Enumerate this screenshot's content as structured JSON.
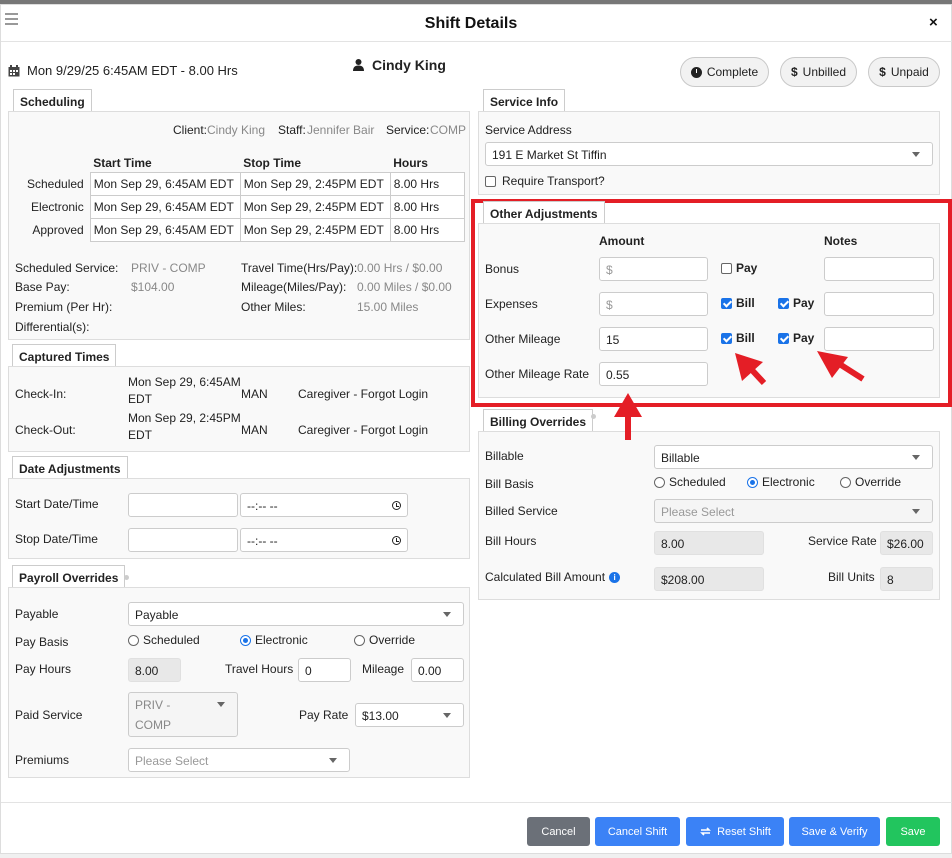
{
  "window": {
    "title": "Shift Details",
    "close": "×"
  },
  "header": {
    "date_line": "Mon 9/29/25 6:45AM EDT - 8.00 Hrs",
    "person": "Cindy King",
    "buttons": {
      "complete": "Complete",
      "unbilled": "Unbilled",
      "unpaid": "Unpaid",
      "dollar": "$"
    }
  },
  "scheduling": {
    "tab": "Scheduling",
    "client_label": "Client:",
    "client": "Cindy King",
    "staff_label": "Staff:",
    "staff": "Jennifer Bair",
    "service_label": "Service:",
    "service": "COMP",
    "columns": [
      "Start Time",
      "Stop Time",
      "Hours"
    ],
    "rows": [
      {
        "label": "Scheduled",
        "start": "Mon Sep 29, 6:45AM EDT",
        "stop": "Mon Sep 29, 2:45PM EDT",
        "hours": "8.00 Hrs"
      },
      {
        "label": "Electronic",
        "start": "Mon Sep 29, 6:45AM EDT",
        "stop": "Mon Sep 29, 2:45PM EDT",
        "hours": "8.00 Hrs"
      },
      {
        "label": "Approved",
        "start": "Mon Sep 29, 6:45AM EDT",
        "stop": "Mon Sep 29, 2:45PM EDT",
        "hours": "8.00 Hrs"
      }
    ],
    "scheduled_service_label": "Scheduled Service:",
    "scheduled_service": "PRIV - COMP",
    "base_pay_label": "Base Pay:",
    "base_pay": "$104.00",
    "premium_label": "Premium (Per Hr):",
    "differential_label": "Differential(s):",
    "travel_label": "Travel Time(Hrs/Pay):",
    "travel": "0.00 Hrs / $0.00",
    "mileage_label": "Mileage(Miles/Pay):",
    "mileage": "0.00 Miles / $0.00",
    "other_miles_label": "Other Miles:",
    "other_miles": "15.00 Miles"
  },
  "captured": {
    "tab": "Captured Times",
    "checkin_label": "Check-In:",
    "checkin_l1": "Mon Sep 29, 6:45AM",
    "checkin_l2": "EDT",
    "checkin_method": "MAN",
    "checkin_reason": "Caregiver - Forgot Login",
    "checkout_label": "Check-Out:",
    "checkout_l1": "Mon Sep 29, 2:45PM",
    "checkout_l2": "EDT",
    "checkout_method": "MAN",
    "checkout_reason": "Caregiver - Forgot Login"
  },
  "date_adj": {
    "tab": "Date Adjustments",
    "start_label": "Start Date/Time",
    "stop_label": "Stop Date/Time",
    "time_placeholder": "--:-- --"
  },
  "payroll": {
    "tab": "Payroll Overrides",
    "payable_label": "Payable",
    "payable": "Payable",
    "pay_basis_label": "Pay Basis",
    "basis": [
      "Scheduled",
      "Electronic",
      "Override"
    ],
    "pay_hours_label": "Pay Hours",
    "pay_hours": "8.00",
    "travel_hours_label": "Travel Hours",
    "travel_hours": "0",
    "mileage_label": "Mileage",
    "mileage": "0.00",
    "paid_service_label": "Paid Service",
    "paid_service_l1": "PRIV -",
    "paid_service_l2": "COMP",
    "pay_rate_label": "Pay Rate",
    "pay_rate": "$13.00",
    "premiums_label": "Premiums",
    "premiums_placeholder": "Please Select"
  },
  "service_info": {
    "tab": "Service Info",
    "address_label": "Service Address",
    "address": "191 E Market St Tiffin",
    "transport_label": "Require Transport?"
  },
  "other_adj": {
    "tab": "Other Adjustments",
    "amount_header": "Amount",
    "notes_header": "Notes",
    "bonus_label": "Bonus",
    "expenses_label": "Expenses",
    "other_mileage_label": "Other Mileage",
    "other_mileage": "15",
    "rate_label": "Other Mileage Rate",
    "rate": "0.55",
    "dollar_placeholder": "$",
    "bill": "Bill",
    "pay": "Pay"
  },
  "billing": {
    "tab": "Billing Overrides",
    "billable_label": "Billable",
    "billable": "Billable",
    "bill_basis_label": "Bill Basis",
    "basis": [
      "Scheduled",
      "Electronic",
      "Override"
    ],
    "billed_service_label": "Billed Service",
    "billed_service_placeholder": "Please Select",
    "bill_hours_label": "Bill Hours",
    "bill_hours": "8.00",
    "service_rate_label": "Service Rate",
    "service_rate": "$26.00",
    "calc_label": "Calculated Bill Amount",
    "calc": "$208.00",
    "units_label": "Bill Units",
    "units": "8"
  },
  "footer": {
    "cancel": "Cancel",
    "cancel_shift": "Cancel Shift",
    "reset_shift": "Reset Shift",
    "save_verify": "Save & Verify",
    "save": "Save"
  },
  "colors": {
    "highlight": "#e41e26",
    "primary": "#3b82f6",
    "success": "#22c55e",
    "grey": "#6b7078"
  }
}
